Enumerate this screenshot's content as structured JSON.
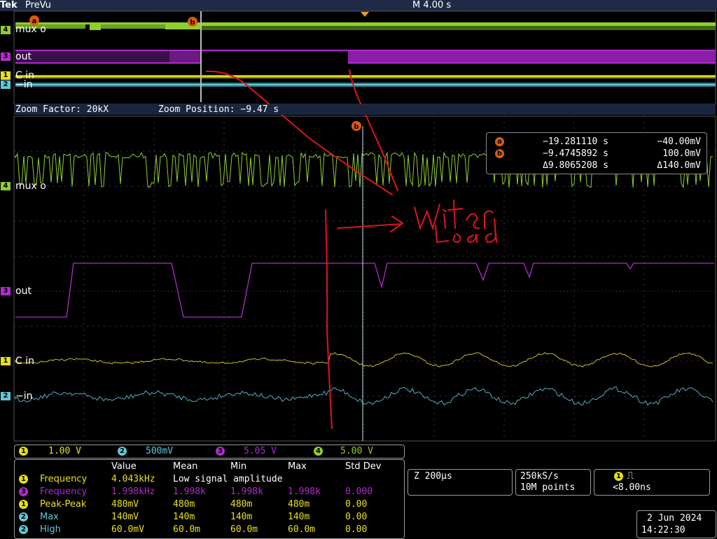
{
  "app": {
    "brand": "Tek",
    "acq_state": "PreVu",
    "timebase": "M 4.00 s"
  },
  "zoom": {
    "factor": "Zoom Factor: 20kX",
    "position": "Zoom Position: −9.47 s"
  },
  "channels": [
    {
      "num": "4",
      "label": "mux o",
      "color": "#8fcf2a"
    },
    {
      "num": "3",
      "label": "out",
      "color": "#b02ad0"
    },
    {
      "num": "1",
      "label": "C in",
      "color": "#e8e018"
    },
    {
      "num": "2",
      "label": "−in",
      "color": "#5fc8d8"
    }
  ],
  "cursors": {
    "a": {
      "marker": "a",
      "time": "−19.281110 s",
      "value": "−40.00mV"
    },
    "b": {
      "marker": "b",
      "time": "−9.4745892 s",
      "value": "100.0mV"
    },
    "delta": {
      "time": "Δ9.8065208 s",
      "value": "Δ140.0mV"
    }
  },
  "annotation": {
    "line1": "Writer",
    "line2": "Load",
    "color": "#e0141e"
  },
  "scales": [
    {
      "num": "1",
      "value": "1.00 V",
      "color": "#e8e018"
    },
    {
      "num": "2",
      "value": "500mV",
      "color": "#5fc8d8"
    },
    {
      "num": "3",
      "value": "5.05 V",
      "color": "#b02ad0"
    },
    {
      "num": "4",
      "value": "5.00 V",
      "color": "#8fcf2a"
    }
  ],
  "measurements": {
    "headers": [
      "Value",
      "Mean",
      "Min",
      "Max",
      "Std Dev"
    ],
    "rows": [
      {
        "ch": "1",
        "color": "#e8e018",
        "name": "Frequency",
        "value": "4.043kHz",
        "mean": "Low signal amplitude",
        "min": "",
        "max": "",
        "std": ""
      },
      {
        "ch": "3",
        "color": "#b02ad0",
        "name": "Frequency",
        "value": "1.998kHz",
        "mean": "1.998k",
        "min": "1.998k",
        "max": "1.998k",
        "std": "0.000"
      },
      {
        "ch": "1",
        "color": "#e8e018",
        "name": "Peak-Peak",
        "value": "480mV",
        "mean": "480m",
        "min": "480m",
        "max": "480m",
        "std": "0.00"
      },
      {
        "ch": "2",
        "color": "#5fc8d8",
        "name": "Max",
        "value": "140mV",
        "mean": "140m",
        "min": "140m",
        "max": "140m",
        "std": "0.00"
      },
      {
        "ch": "2",
        "color": "#5fc8d8",
        "name": "High",
        "value": "60.0mV",
        "mean": "60.0m",
        "min": "60.0m",
        "max": "60.0m",
        "std": "0.00"
      }
    ]
  },
  "horizontal": {
    "zoom_scale": "Z 200μs",
    "sample_rate": "250kS/s",
    "record_length": "10M points"
  },
  "trigger": {
    "source": "1",
    "symbol": "⎍",
    "setting": "<8.00ns"
  },
  "datetime": {
    "date": "2 Jun  2024",
    "time": "14:22:30"
  }
}
